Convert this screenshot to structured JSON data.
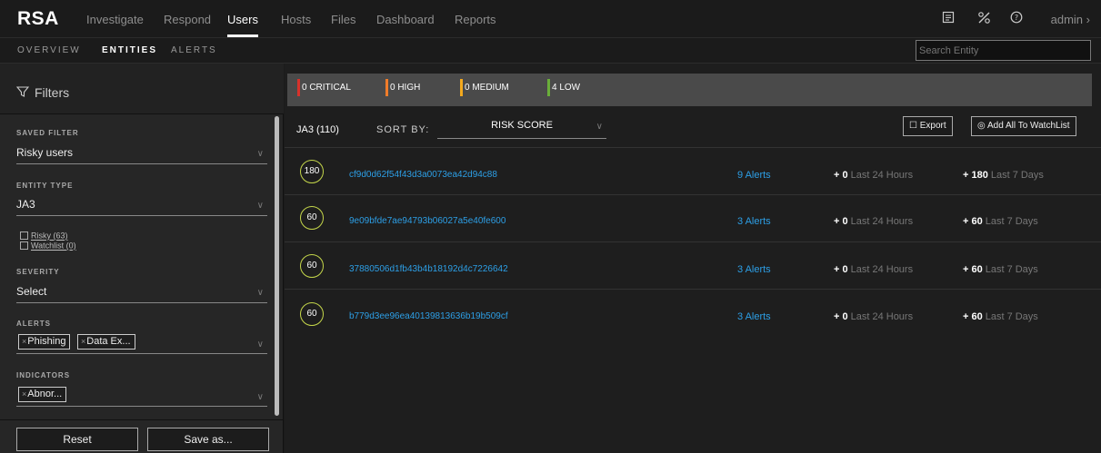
{
  "nav": {
    "logo": "RSA",
    "items": [
      "Investigate",
      "Respond",
      "Users",
      "Hosts",
      "Files",
      "Dashboard",
      "Reports"
    ],
    "active": "Users",
    "user": "admin",
    "icons": [
      "report-icon",
      "tools-icon",
      "help-icon"
    ]
  },
  "subnav": {
    "items": [
      "OVERVIEW",
      "ENTITIES",
      "ALERTS"
    ],
    "active": "ENTITIES",
    "search_placeholder": "Search Entity"
  },
  "filters": {
    "title": "Filters",
    "saved_filter_label": "SAVED FILTER",
    "saved_filter_value": "Risky users",
    "entity_type_label": "ENTITY TYPE",
    "entity_type_value": "JA3",
    "risky": "Risky (63)",
    "watchlist": "Watchlist (0)",
    "severity_label": "SEVERITY",
    "severity_value": "Select",
    "alerts_label": "ALERTS",
    "alert_chips": [
      "Phishing",
      "Data Ex..."
    ],
    "indicators_label": "INDICATORS",
    "indicator_chips": [
      "Abnor..."
    ],
    "reset": "Reset",
    "save_as": "Save as..."
  },
  "severity": [
    {
      "label": "0 CRITICAL",
      "color": "#d7322b"
    },
    {
      "label": "0 HIGH",
      "color": "#f07c2a"
    },
    {
      "label": "0 MEDIUM",
      "color": "#f3a91e"
    },
    {
      "label": "4 LOW",
      "color": "#6aae3a"
    }
  ],
  "list": {
    "count": "JA3 (110)",
    "sort_by_label": "SORT BY:",
    "sort_value": "RISK SCORE",
    "export": "Export",
    "add_watchlist": "Add All To WatchList",
    "last24": "Last 24 Hours",
    "last7": "Last 7 Days",
    "rows": [
      {
        "score": "180",
        "entity": "cf9d0d62f54f43d3a0073ea42d94c88",
        "alerts": "9 Alerts",
        "d24": "+ 0",
        "d7": "+ 180"
      },
      {
        "score": "60",
        "entity": "9e09bfde7ae94793b06027a5e40fe600",
        "alerts": "3 Alerts",
        "d24": "+ 0",
        "d7": "+ 60"
      },
      {
        "score": "60",
        "entity": "37880506d1fb43b4b18192d4c7226642",
        "alerts": "3 Alerts",
        "d24": "+ 0",
        "d7": "+ 60"
      },
      {
        "score": "60",
        "entity": "b779d3ee96ea40139813636b19b509cf",
        "alerts": "3 Alerts",
        "d24": "+ 0",
        "d7": "+ 60"
      }
    ]
  },
  "colors": {
    "score_ring": "#c4d64a",
    "link": "#2d9fe6",
    "sev_bar_bg": "#4a4a4a"
  }
}
